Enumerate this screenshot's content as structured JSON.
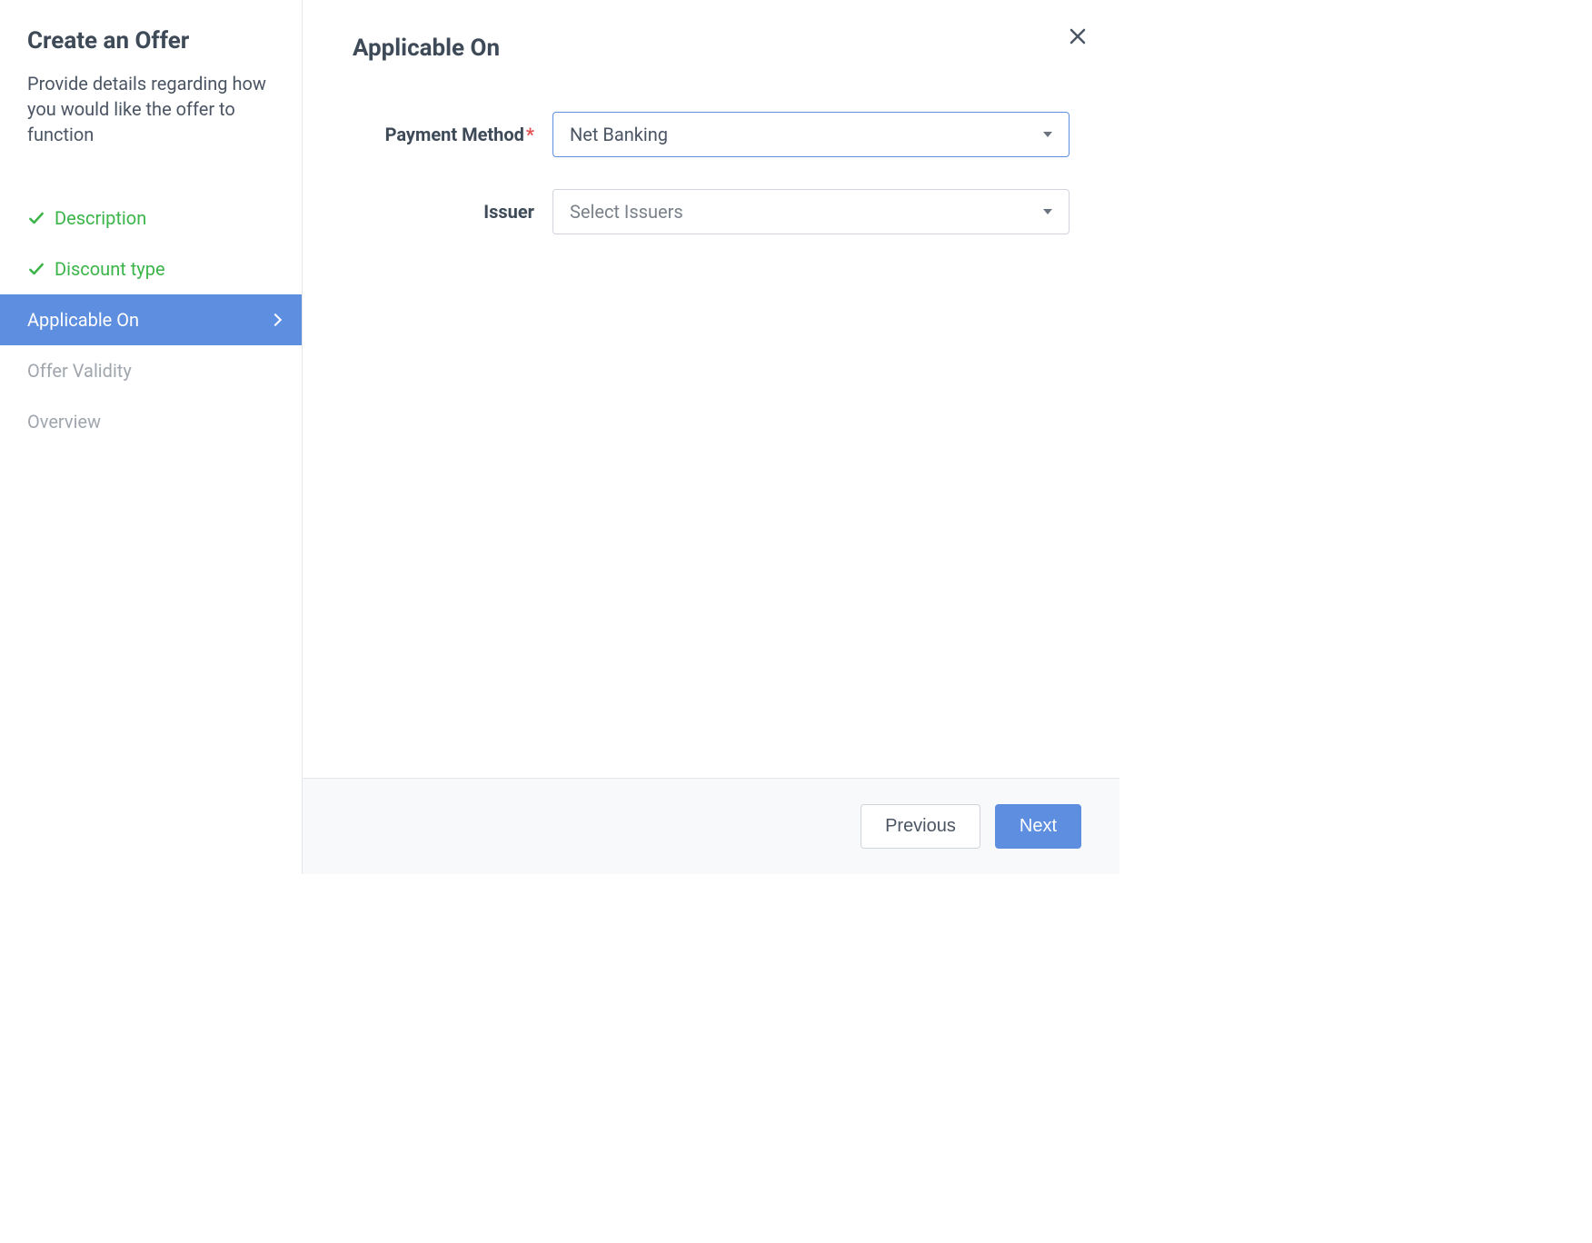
{
  "sidebar": {
    "title": "Create an Offer",
    "subtitle": "Provide details regarding how you would like the offer to function",
    "steps": [
      {
        "label": "Description",
        "status": "completed"
      },
      {
        "label": "Discount type",
        "status": "completed"
      },
      {
        "label": "Applicable On",
        "status": "active"
      },
      {
        "label": "Offer Validity",
        "status": "pending"
      },
      {
        "label": "Overview",
        "status": "pending"
      }
    ]
  },
  "main": {
    "title": "Applicable On",
    "fields": {
      "payment_method": {
        "label": "Payment Method",
        "required": true,
        "value": "Net Banking"
      },
      "issuer": {
        "label": "Issuer",
        "required": false,
        "placeholder": "Select Issuers"
      }
    }
  },
  "footer": {
    "previous": "Previous",
    "next": "Next"
  }
}
